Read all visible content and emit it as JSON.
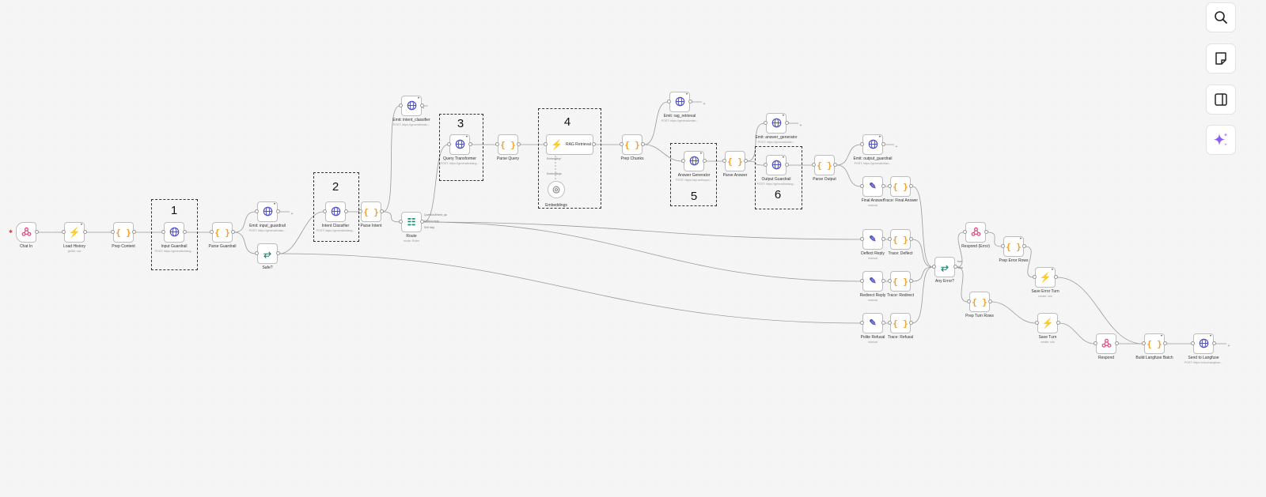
{
  "toolbar": {
    "buttons": [
      {
        "name": "search-icon"
      },
      {
        "name": "sticky-note-icon"
      },
      {
        "name": "panel-toggle-icon"
      },
      {
        "name": "ai-sparkle-icon",
        "color": "#8b5cf6"
      }
    ]
  },
  "nodes": {
    "chat_in": {
      "label": "Chat In",
      "icon": "webhook-icon"
    },
    "load_history": {
      "label": "Load History",
      "sub": "getAll: row",
      "icon": "bolt-icon"
    },
    "prep_content": {
      "label": "Prep Content",
      "icon": "code-icon"
    },
    "input_guardrail": {
      "label": "Input Guardrail",
      "sub": "POST: https://generativelang...",
      "icon": "globe-icon"
    },
    "parse_guardrail": {
      "label": "Parse Guardrail",
      "icon": "code-icon"
    },
    "emit_input_guardrail": {
      "label": "Emit: input_guardrail",
      "sub": "POST: https://generativelan...",
      "icon": "globe-icon"
    },
    "safe": {
      "label": "Safe?",
      "icon": "if-icon"
    },
    "intent_classifier": {
      "label": "Intent Classifier",
      "sub": "POST: https://generativelang...",
      "icon": "globe-icon"
    },
    "parse_intent": {
      "label": "Parse Intent",
      "icon": "code-icon"
    },
    "emit_intent_classifier": {
      "label": "Emit: intent_classifier",
      "sub": "POST: https://generativelan...",
      "icon": "globe-icon"
    },
    "route": {
      "label": "Route",
      "sub": "mode: Rules",
      "icon": "switch-icon",
      "outputs": [
        "Question/Intent_qa",
        "Deflect reply",
        "Self help"
      ]
    },
    "query_transformer": {
      "label": "Query Transformer",
      "sub": "POST: https://generativelang...",
      "icon": "globe-icon"
    },
    "parse_query": {
      "label": "Parse Query",
      "icon": "code-icon"
    },
    "rag_retrieval": {
      "label": "RAG Retrieval",
      "icon": "bolt-icon",
      "ports": [
        "Embedding*",
        "Embeddings"
      ]
    },
    "embeddings": {
      "label": "Embeddings",
      "icon": "embeddings-icon"
    },
    "prep_chunks": {
      "label": "Prep Chunks",
      "icon": "code-icon"
    },
    "emit_rag_retrieval": {
      "label": "Emit: rag_retrieval",
      "sub": "POST: https://generativelan...",
      "icon": "globe-icon"
    },
    "answer_generator": {
      "label": "Answer Generator",
      "sub": "POST: https://api.anthropic...",
      "icon": "globe-icon"
    },
    "parse_answer": {
      "label": "Parse Answer",
      "icon": "code-icon"
    },
    "emit_answer_generator": {
      "label": "Emit: answer_generator",
      "sub": "POST: https://generativelan...",
      "icon": "globe-icon"
    },
    "output_guardrail": {
      "label": "Output Guardrail",
      "sub": "POST: https://generativelang...",
      "icon": "globe-icon"
    },
    "parse_output": {
      "label": "Parse Output",
      "icon": "code-icon"
    },
    "emit_output_guardrail": {
      "label": "Emit: output_guardrail",
      "sub": "POST: https://generativelan...",
      "icon": "globe-icon"
    },
    "final_answer": {
      "label": "Final Answer",
      "sub": "manual",
      "icon": "edit-icon"
    },
    "trace_final_answer": {
      "label": "Trace: Final Answer",
      "icon": "code-icon"
    },
    "deflect_reply": {
      "label": "Deflect Reply",
      "sub": "manual",
      "icon": "edit-icon"
    },
    "trace_deflect": {
      "label": "Trace: Deflect",
      "icon": "code-icon"
    },
    "redirect_reply": {
      "label": "Redirect Reply",
      "sub": "manual",
      "icon": "edit-icon"
    },
    "trace_redirect": {
      "label": "Trace: Redirect",
      "icon": "code-icon"
    },
    "polite_refusal": {
      "label": "Polite Refusal",
      "sub": "manual",
      "icon": "edit-icon"
    },
    "trace_refusal": {
      "label": "Trace: Refusal",
      "icon": "code-icon"
    },
    "any_error": {
      "label": "Any Error?",
      "icon": "if-icon",
      "outputs": [
        "true",
        "false"
      ]
    },
    "respond_error": {
      "label": "Respond (Error)",
      "icon": "webhook-icon"
    },
    "prep_error_rows": {
      "label": "Prep Error Rows",
      "icon": "code-icon"
    },
    "save_error_turn": {
      "label": "Save Error Turn",
      "sub": "create: row",
      "icon": "bolt-icon"
    },
    "prep_turn_rows": {
      "label": "Prep Turn Rows",
      "icon": "code-icon"
    },
    "save_turn": {
      "label": "Save Turn",
      "sub": "create: row",
      "icon": "bolt-icon"
    },
    "respond": {
      "label": "Respond",
      "icon": "webhook-icon"
    },
    "build_langfuse_batch": {
      "label": "Build Langfuse Batch",
      "icon": "code-icon"
    },
    "send_to_langfuse": {
      "label": "Send to Langfuse",
      "sub": "POST: https://cloud.langfuse...",
      "icon": "globe-icon"
    }
  },
  "groups": [
    {
      "number": "1"
    },
    {
      "number": "2"
    },
    {
      "number": "3"
    },
    {
      "number": "4"
    },
    {
      "number": "5"
    },
    {
      "number": "6"
    }
  ],
  "colors": {
    "code": "#f0a030",
    "http": "#4f52c2",
    "bolt": "#2aa36b",
    "webhook": "#e0457b",
    "route": "#18866f",
    "edge": "#9a9a9a"
  }
}
